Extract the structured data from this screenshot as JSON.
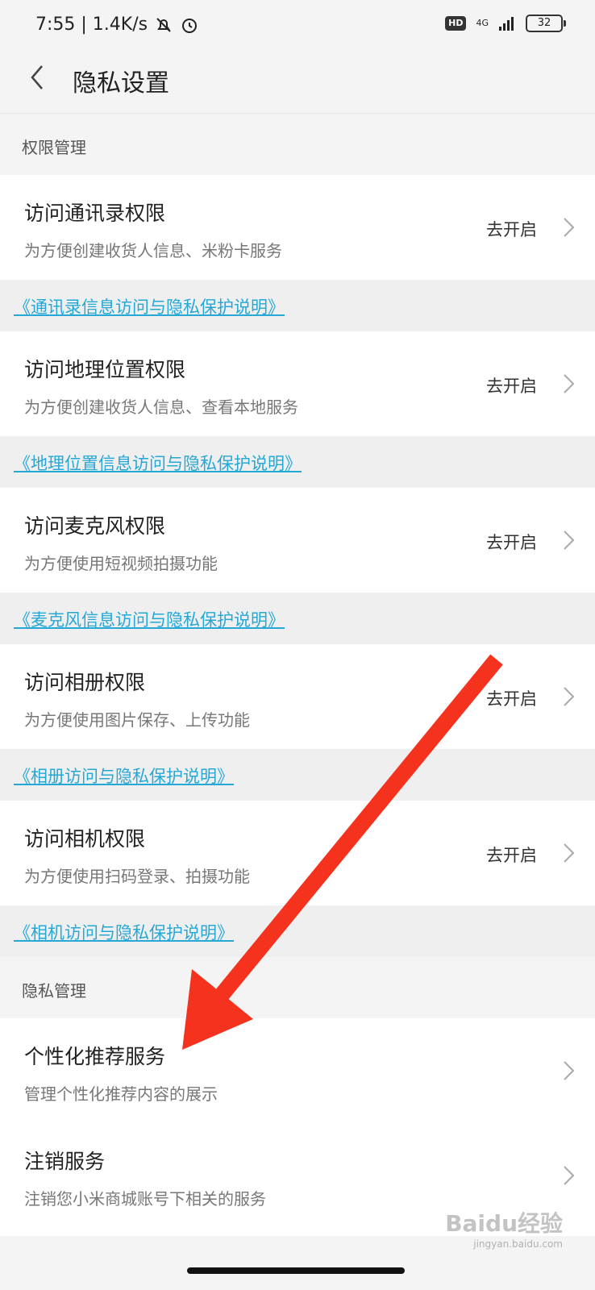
{
  "status_bar": {
    "time_speed": "7:55 | 1.4K/s",
    "hd": "HD",
    "network": "4G",
    "battery": "32"
  },
  "nav": {
    "title": "隐私设置"
  },
  "sections": {
    "permission_header": "权限管理",
    "privacy_header": "隐私管理"
  },
  "permissions": [
    {
      "title": "访问通讯录权限",
      "desc": "为方便创建收货人信息、米粉卡服务",
      "action": "去开启",
      "link": "《通讯录信息访问与隐私保护说明》"
    },
    {
      "title": "访问地理位置权限",
      "desc": "为方便创建收货人信息、查看本地服务",
      "action": "去开启",
      "link": "《地理位置信息访问与隐私保护说明》"
    },
    {
      "title": "访问麦克风权限",
      "desc": "为方便使用短视频拍摄功能",
      "action": "去开启",
      "link": "《麦克风信息访问与隐私保护说明》"
    },
    {
      "title": "访问相册权限",
      "desc": "为方便使用图片保存、上传功能",
      "action": "去开启",
      "link": "《相册访问与隐私保护说明》"
    },
    {
      "title": "访问相机权限",
      "desc": "为方便使用扫码登录、拍摄功能",
      "action": "去开启",
      "link": "《相机访问与隐私保护说明》"
    }
  ],
  "privacy_items": [
    {
      "title": "个性化推荐服务",
      "desc": "管理个性化推荐内容的展示"
    },
    {
      "title": "注销服务",
      "desc": "注销您小米商城账号下相关的服务"
    }
  ],
  "watermark": {
    "brand": "Baidu经验",
    "url": "jingyan.baidu.com"
  },
  "colors": {
    "link": "#26a8d6",
    "arrow": "#f5321e",
    "background": "#f4f4f4"
  }
}
